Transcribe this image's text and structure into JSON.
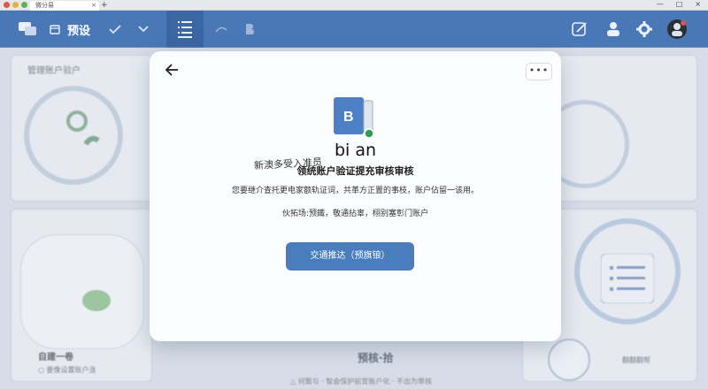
{
  "browser": {
    "tab_title": "微分易",
    "tab_close": "×",
    "new_tab": "+",
    "window_controls": [
      "—",
      "□",
      "×"
    ]
  },
  "toolbar": {
    "preview_label": "预设",
    "colors": {
      "bar": "#4a78b7",
      "active": "#3c66a3"
    }
  },
  "background": {
    "manage_accounts_title": "管理账户验户",
    "card_label": "自建一卷",
    "card_sublabel": "○ 要像设置账户涨",
    "center_caption": "预核·拾",
    "footer_note": "△ 何暂与 · 智会保护前宜账户化 · 不出为审核",
    "side_footer": "翻翻翻帮"
  },
  "modal": {
    "app_name": "bi an",
    "handwritten_note": "新澳多受入准员",
    "title": "领统账户验证提充审核审核",
    "description": "您要继介查托更电家额轨证词，共革方正置的事枝，账户佔留一该用。",
    "hint": "伙拓场:预鐵，敬通拈辜，栩别塞彰门账户",
    "primary_button": "交通推达（预旗锒）",
    "more_label": "•••",
    "logo_letter": "B",
    "accent_color": "#4a7dbb"
  }
}
